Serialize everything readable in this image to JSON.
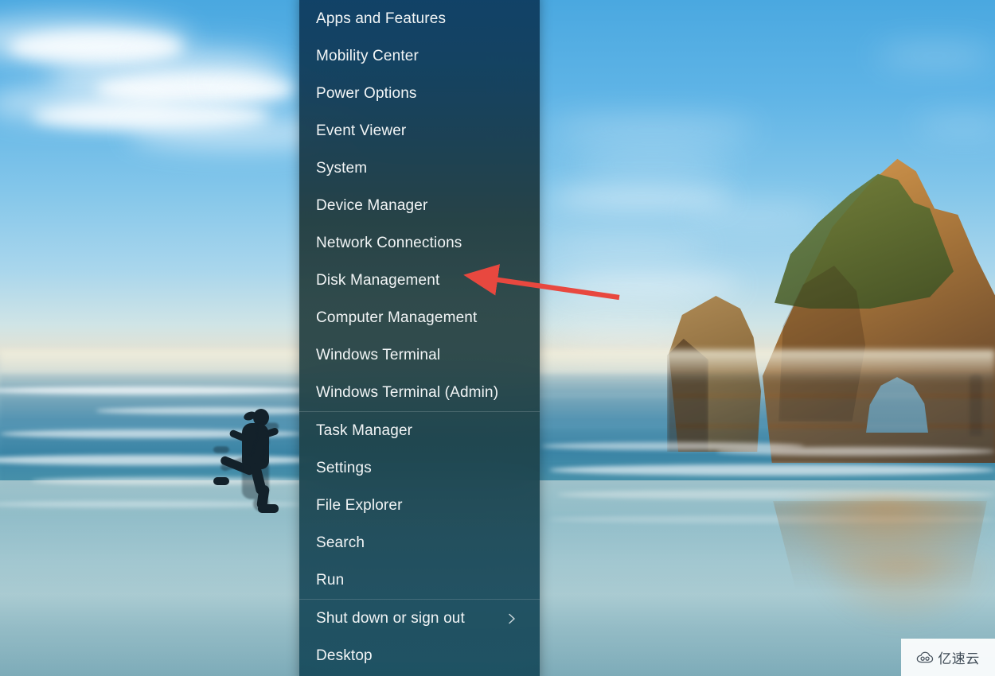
{
  "wallpaper": {
    "name": "windows-11-bloom-beach-wallpaper",
    "alt": "Beach at Wharariki with archway rock islands, ocean, blue sky with clouds and a running person silhouette"
  },
  "menu": {
    "name": "Windows X / Quick Link power-user menu",
    "items": [
      {
        "label": "Apps and Features",
        "type": "item"
      },
      {
        "label": "Mobility Center",
        "type": "item"
      },
      {
        "label": "Power Options",
        "type": "item"
      },
      {
        "label": "Event Viewer",
        "type": "item"
      },
      {
        "label": "System",
        "type": "item"
      },
      {
        "label": "Device Manager",
        "type": "item"
      },
      {
        "label": "Network Connections",
        "type": "item"
      },
      {
        "label": "Disk Management",
        "type": "item"
      },
      {
        "label": "Computer Management",
        "type": "item"
      },
      {
        "label": "Windows Terminal",
        "type": "item"
      },
      {
        "label": "Windows Terminal (Admin)",
        "type": "item"
      },
      {
        "label": "",
        "type": "separator"
      },
      {
        "label": "Task Manager",
        "type": "item"
      },
      {
        "label": "Settings",
        "type": "item"
      },
      {
        "label": "File Explorer",
        "type": "item"
      },
      {
        "label": "Search",
        "type": "item"
      },
      {
        "label": "Run",
        "type": "item"
      },
      {
        "label": "",
        "type": "separator"
      },
      {
        "label": "Shut down or sign out",
        "type": "item",
        "submenu": true,
        "chevron_icon": "chevron-right-icon"
      },
      {
        "label": "Desktop",
        "type": "item"
      }
    ]
  },
  "annotation": {
    "type": "arrow",
    "color": "#e8483f",
    "points_to": "Disk Management",
    "direction": "left"
  },
  "watermark": {
    "icon": "cloud-icon",
    "text": "亿速云"
  },
  "colors": {
    "menu_top": "#0d3a5e",
    "menu_middle": "#253f3f",
    "menu_bottom": "#174a5c",
    "menu_text": "#f2f5f6",
    "separator": "rgba(255,255,255,0.16)",
    "arrow_red": "#e8483f",
    "sky_blue": "#4aa8e0",
    "rock_gold": "#c08844"
  }
}
